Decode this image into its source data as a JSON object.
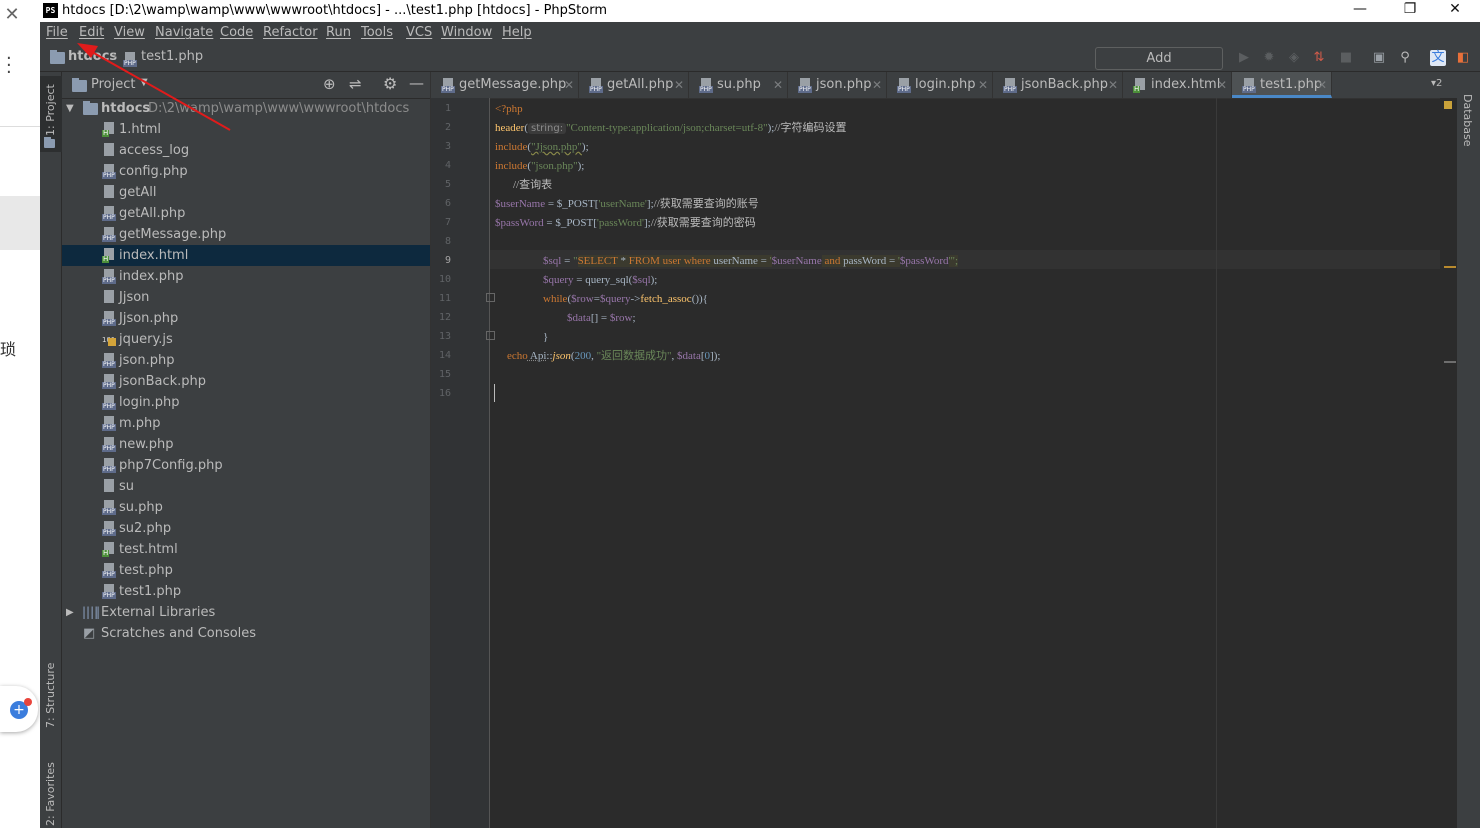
{
  "left_app": {
    "close": "✕",
    "cjk": "琐"
  },
  "window": {
    "title": "htdocs [D:\\2\\wamp\\wamp\\www\\wwwroot\\htdocs] - ...\\test1.php [htdocs] - PhpStorm",
    "logo": "PS",
    "minimize": "—",
    "restore": "❐",
    "close": "✕"
  },
  "menu": [
    "File",
    "Edit",
    "View",
    "Navigate",
    "Code",
    "Refactor",
    "Run",
    "Tools",
    "VCS",
    "Window",
    "Help"
  ],
  "navbar": {
    "breadcrumb_root": "htdocs",
    "breadcrumb_file": "test1.php",
    "add_configuration": "Add Configuration..."
  },
  "leftstrip": {
    "project": "1: Project",
    "structure": "7: Structure",
    "favorites": "2: Favorites"
  },
  "rightstrip": {
    "database": "Database"
  },
  "project": {
    "header": "Project",
    "root_name": "htdocs",
    "root_path": "D:\\2\\wamp\\wamp\\www\\wwwroot\\htdocs",
    "files": [
      {
        "name": "1.html",
        "type": "html"
      },
      {
        "name": "access_log",
        "type": "file"
      },
      {
        "name": "config.php",
        "type": "php"
      },
      {
        "name": "getAll",
        "type": "file"
      },
      {
        "name": "getAll.php",
        "type": "php"
      },
      {
        "name": "getMessage.php",
        "type": "php"
      },
      {
        "name": "index.html",
        "type": "html",
        "selected": true
      },
      {
        "name": "index.php",
        "type": "php"
      },
      {
        "name": "Jjson",
        "type": "file"
      },
      {
        "name": "Jjson.php",
        "type": "php"
      },
      {
        "name": "jquery.js",
        "type": "js"
      },
      {
        "name": "json.php",
        "type": "php"
      },
      {
        "name": "jsonBack.php",
        "type": "php"
      },
      {
        "name": "login.php",
        "type": "php"
      },
      {
        "name": "m.php",
        "type": "php"
      },
      {
        "name": "new.php",
        "type": "php"
      },
      {
        "name": "php7Config.php",
        "type": "php"
      },
      {
        "name": "su",
        "type": "file"
      },
      {
        "name": "su.php",
        "type": "php"
      },
      {
        "name": "su2.php",
        "type": "php"
      },
      {
        "name": "test.html",
        "type": "html"
      },
      {
        "name": "test.php",
        "type": "php"
      },
      {
        "name": "test1.php",
        "type": "php"
      }
    ],
    "external_libraries": "External Libraries",
    "scratches": "Scratches and Consoles"
  },
  "tabs": [
    {
      "name": "getMessage.php",
      "type": "php"
    },
    {
      "name": "getAll.php",
      "type": "php"
    },
    {
      "name": "su.php",
      "type": "php"
    },
    {
      "name": "json.php",
      "type": "php"
    },
    {
      "name": "login.php",
      "type": "php"
    },
    {
      "name": "jsonBack.php",
      "type": "php"
    },
    {
      "name": "index.html",
      "type": "html"
    },
    {
      "name": "test1.php",
      "type": "php",
      "active": true
    }
  ],
  "tab_overflow": "▾2",
  "line_numbers": [
    "1",
    "2",
    "3",
    "4",
    "5",
    "6",
    "7",
    "8",
    "9",
    "10",
    "11",
    "12",
    "13",
    "14",
    "15",
    "16"
  ],
  "code": {
    "l1": "<?php",
    "l2_fn": "header",
    "l2_hint": "string:",
    "l2_str": "\"Content-type:application/json;charset=utf-8\"",
    "l2_tail": ");",
    "l2_cm": "//字符编码设置",
    "l3_kw": "include",
    "l3_str": "\"Jjson.php\"",
    "l4_kw": "include",
    "l4_str": "\"json.php\"",
    "l5_cm": "//查询表",
    "l6_var": "$userName",
    "l6_mid": " = $_POST[",
    "l6_str": "'userName'",
    "l6_tail": "];",
    "l6_cm": "//获取需要查询的账号",
    "l7_var": "$passWord",
    "l7_mid": " = $_POST[",
    "l7_str": "'passWord'",
    "l7_tail": "];",
    "l7_cm": "//获取需要查询的密码",
    "l9_var": "$sql",
    "l9_eq": " = ",
    "l9_q": "\"",
    "l9_select": "SELECT",
    "l9_star": " * ",
    "l9_from": "FROM",
    "l9_user": " user ",
    "l9_where": "where",
    "l9_col1": " userName = ",
    "l9_q1": "'",
    "l9_v1": "$userName",
    "l9_and": " and",
    "l9_col2": " passWord = ",
    "l9_v2": "$passWord",
    "l9_end": "'\";",
    "l10_var": "$query",
    "l10_mid": " = query_sql(",
    "l10_arg": "$sql",
    "l10_tail": ");",
    "l11_kw": "while",
    "l11_a": "(",
    "l11_v1": "$row",
    "l11_b": "=",
    "l11_v2": "$query",
    "l11_c": "->",
    "l11_fn": "fetch_assoc",
    "l11_d": "()){",
    "l12_var": "$data",
    "l12_mid": "[] = ",
    "l12_v": "$row",
    "l12_tail": ";",
    "l13": "}",
    "l14_kw": "echo",
    "l14_cls": " Api",
    "l14_sep": "::",
    "l14_fn": "json",
    "l14_a": "(",
    "l14_num": "200",
    "l14_b": ", ",
    "l14_str": "\"返回数据成功\"",
    "l14_c": ", ",
    "l14_v": "$data",
    "l14_d": "[",
    "l14_n": "0",
    "l14_e": "]);"
  }
}
